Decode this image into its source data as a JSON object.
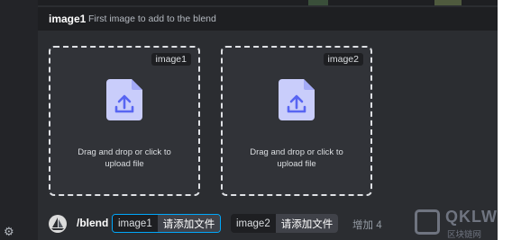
{
  "header": {
    "option_name": "image1",
    "option_description": "First image to add to the blend"
  },
  "dropzones": [
    {
      "tag": "image1",
      "instruction_line1": "Drag and drop or click to",
      "instruction_line2": "upload file"
    },
    {
      "tag": "image2",
      "instruction_line1": "Drag and drop or click to",
      "instruction_line2": "upload file"
    }
  ],
  "command_bar": {
    "command": "/blend",
    "options": [
      {
        "name": "image1",
        "value": "请添加文件"
      },
      {
        "name": "image2",
        "value": "请添加文件"
      }
    ],
    "more_label": "增加 4"
  },
  "watermark": {
    "brand": "QKLW",
    "sub": "区块链网"
  },
  "icons": {
    "settings": "gear-icon",
    "upload": "upload-file-icon",
    "bot_avatar": "sailboat-avatar"
  },
  "colors": {
    "accent": "#5865f2",
    "active_border": "#00a8fc",
    "upload_icon": "#c9cdfb"
  }
}
